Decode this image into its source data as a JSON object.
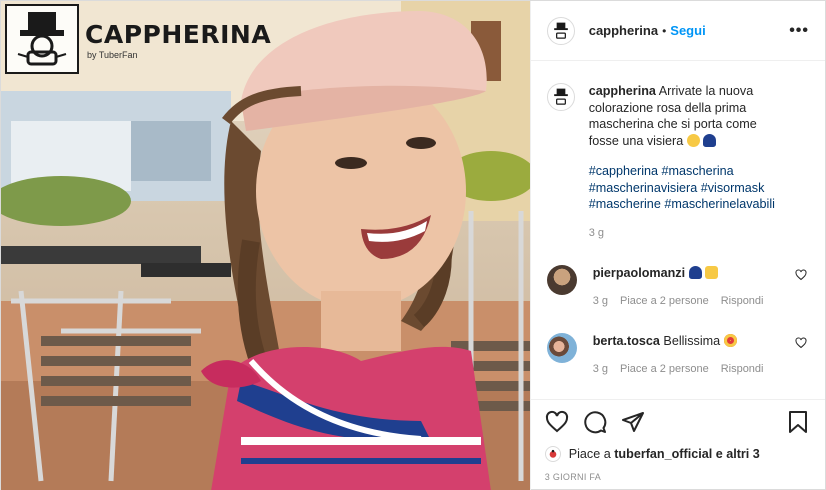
{
  "watermark": {
    "title": "CAPPHERINA",
    "subtitle": "by TuberFan"
  },
  "post": {
    "header": {
      "username": "cappherina",
      "dot": "•",
      "follow_label": "Segui",
      "more_label": "•••"
    },
    "caption": {
      "username": "cappherina",
      "text": "Arrivate la nuova colorazione rosa della prima mascherina che si porta come fosse una visiera",
      "hashtags": [
        "#cappherina",
        "#mascherina",
        "#mascherinavisiera",
        "#visormask",
        "#mascherine",
        "#mascherinelavabili"
      ],
      "time": "3 g"
    },
    "comments": [
      {
        "username": "pierpaolomanzi",
        "text": "",
        "time": "3 g",
        "likes": "Piace a 2 persone",
        "reply": "Rispondi"
      },
      {
        "username": "berta.tosca",
        "text": "Bellissima",
        "time": "3 g",
        "likes": "Piace a 2 persone",
        "reply": "Rispondi"
      }
    ],
    "likes": {
      "prefix": "Piace a",
      "user": "tuberfan_official",
      "suffix": "e altri 3"
    },
    "posted_ago": "3 GIORNI FA"
  },
  "icons": [
    "mask-logo-icon",
    "more-icon",
    "heart-icon",
    "comment-icon",
    "share-icon",
    "bookmark-icon",
    "grimace-emoji-icon",
    "blue-cap-emoji-icon",
    "thumbs-up-emoji-icon",
    "heart-eyes-emoji-icon"
  ],
  "colors": {
    "follow": "#0095f6",
    "hashtag": "#00376b",
    "muted": "#8e8e8e",
    "border": "#dbdbdb"
  }
}
